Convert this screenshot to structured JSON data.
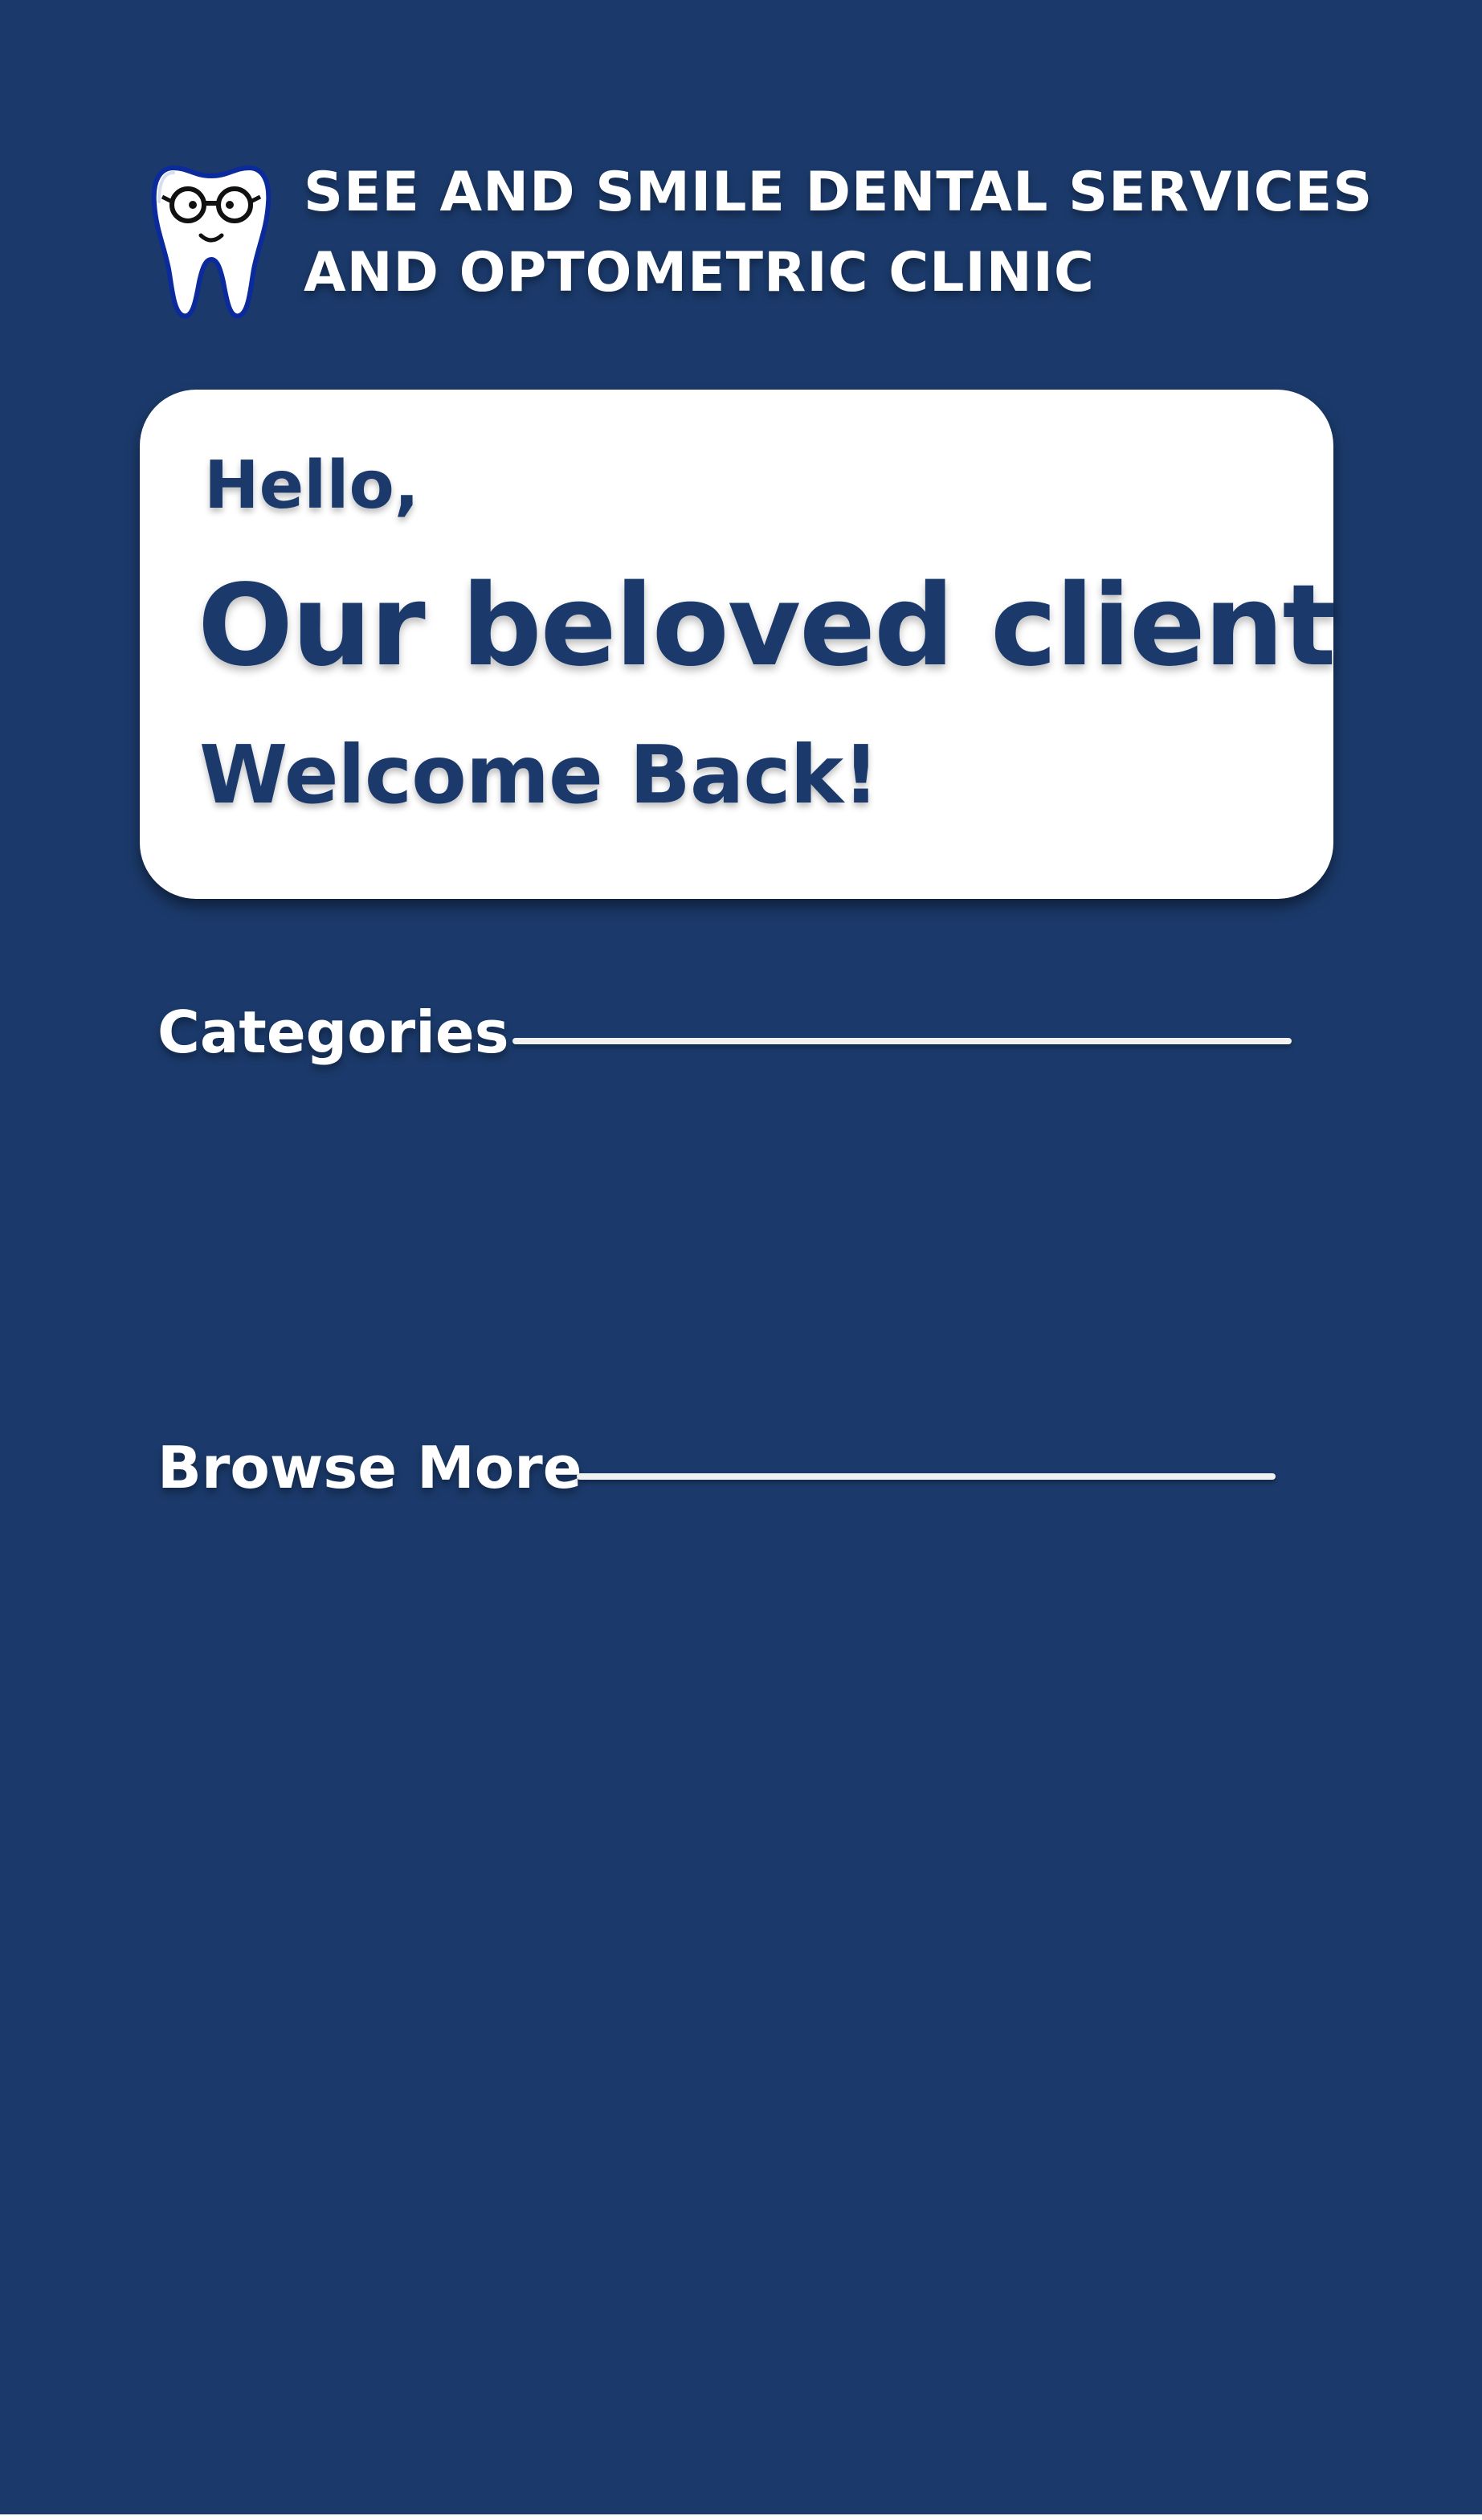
{
  "header": {
    "logo_icon": "tooth-with-glasses-icon",
    "clinic_name_line1": "SEE AND SMILE DENTAL SERVICES",
    "clinic_name_line2": "AND OPTOMETRIC CLINIC"
  },
  "greeting": {
    "hello": "Hello,",
    "client": "Our beloved client",
    "welcome": "Welcome Back!"
  },
  "sections": {
    "categories_title": "Categories",
    "browse_title": "Browse More"
  },
  "colors": {
    "background": "#1b3a6b",
    "card": "#ffffff",
    "text_on_card": "#1b3a6b",
    "text_on_background": "#ffffff"
  }
}
